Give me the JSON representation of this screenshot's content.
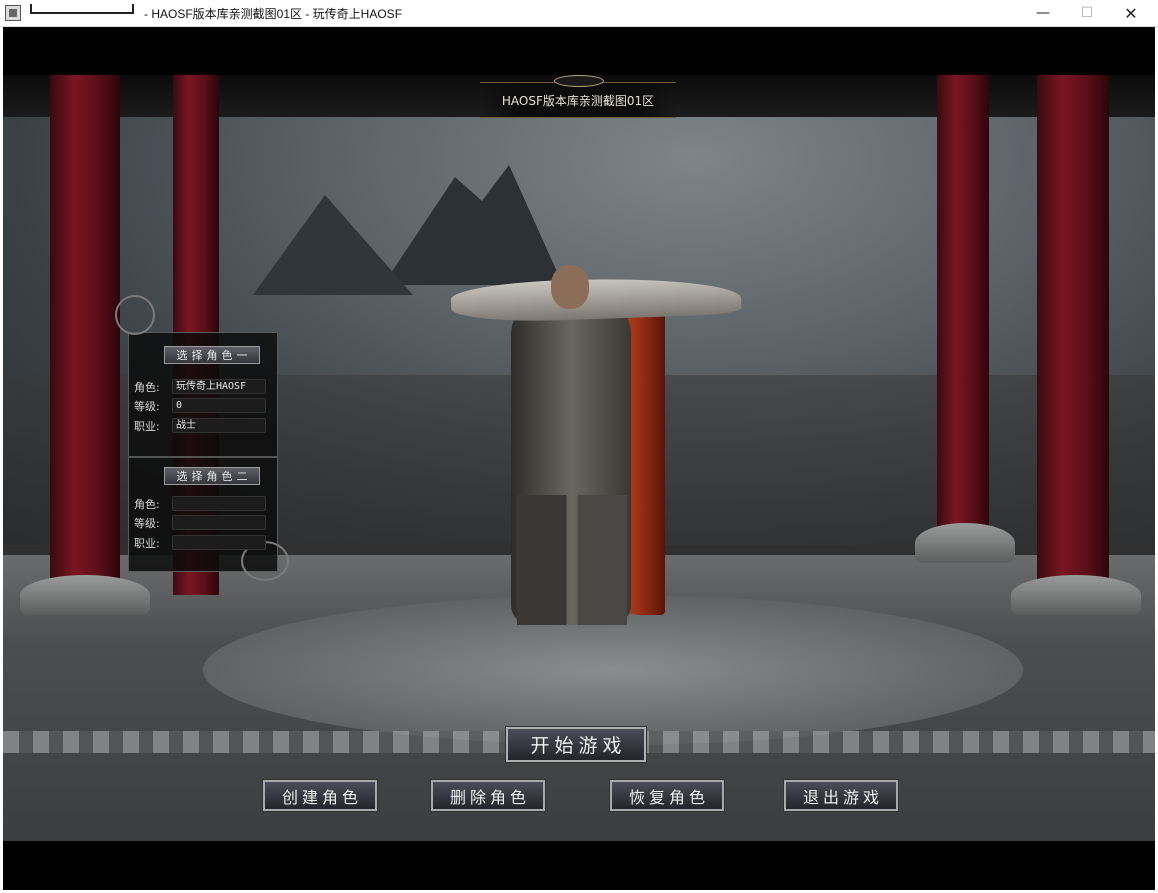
{
  "window": {
    "title": "- HAOSF版本库亲测截图01区 - 玩传奇上HAOSF",
    "minimize_glyph": "—",
    "maximize_glyph": "☐",
    "close_glyph": "✕"
  },
  "game": {
    "server_banner": "HAOSF版本库亲测截图01区"
  },
  "select_panel": {
    "slot1": {
      "button_label": "选择角色一",
      "labels": {
        "name": "角色:",
        "level": "等级:",
        "class": "职业:"
      },
      "values": {
        "name": "玩传奇上HAOSF",
        "level": "0",
        "class": "战士"
      }
    },
    "slot2": {
      "button_label": "选择角色二",
      "labels": {
        "name": "角色:",
        "level": "等级:",
        "class": "职业:"
      },
      "values": {
        "name": "",
        "level": "",
        "class": ""
      }
    }
  },
  "buttons": {
    "start": "开始游戏",
    "create": "创建角色",
    "delete": "删除角色",
    "restore": "恢复角色",
    "exit": "退出游戏"
  }
}
